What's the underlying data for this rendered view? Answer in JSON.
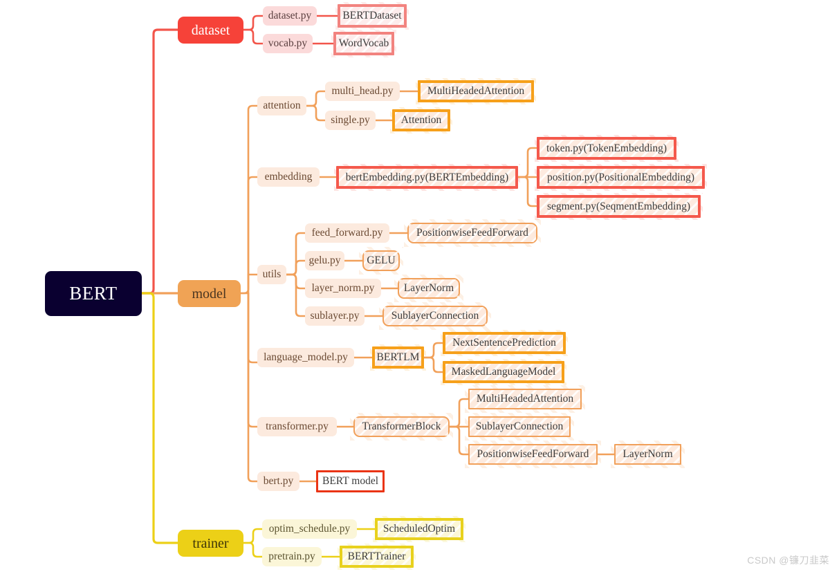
{
  "diagram": {
    "type": "mindmap",
    "title": "BERT",
    "watermark": "CSDN @镰刀韭菜"
  },
  "root": {
    "label": "BERT"
  },
  "branches": {
    "dataset": {
      "label": "dataset",
      "files": [
        {
          "label": "dataset.py",
          "leaf": "BERTDataset"
        },
        {
          "label": "vocab.py",
          "leaf": "WordVocab"
        }
      ]
    },
    "model": {
      "label": "model",
      "attention": {
        "label": "attention",
        "files": [
          {
            "label": "multi_head.py",
            "leaf": "MultiHeadedAttention"
          },
          {
            "label": "single.py",
            "leaf": "Attention"
          }
        ]
      },
      "embedding": {
        "label": "embedding",
        "file": "bertEmbedding.py(BERTEmbedding)",
        "leaves": [
          "token.py(TokenEmbedding)",
          "position.py(PositionalEmbedding)",
          "segment.py(SeqmentEmbedding)"
        ]
      },
      "utils": {
        "label": "utils",
        "files": [
          {
            "label": "feed_forward.py",
            "leaf": "PositionwiseFeedForward"
          },
          {
            "label": "gelu.py",
            "leaf": "GELU"
          },
          {
            "label": "layer_norm.py",
            "leaf": "LayerNorm"
          },
          {
            "label": "sublayer.py",
            "leaf": "SublayerConnection"
          }
        ]
      },
      "language_model": {
        "label": "language_model.py",
        "mid": "BERTLM",
        "leaves": [
          "NextSentencePrediction",
          "MaskedLanguageModel"
        ]
      },
      "transformer": {
        "label": "transformer.py",
        "mid": "TransformerBlock",
        "leaves": [
          "MultiHeadedAttention",
          "SublayerConnection",
          "PositionwiseFeedForward"
        ],
        "tail": "LayerNorm"
      },
      "bert": {
        "label": "bert.py",
        "leaf": "BERT model"
      }
    },
    "trainer": {
      "label": "trainer",
      "files": [
        {
          "label": "optim_schedule.py",
          "leaf": "ScheduledOptim"
        },
        {
          "label": "pretrain.py",
          "leaf": "BERTTrainer"
        }
      ]
    }
  },
  "colors": {
    "root_bg": "#0a0030",
    "dataset": "#f64239",
    "model": "#f0a355",
    "trainer": "#ecd017",
    "edge_red": "#f2554a",
    "edge_orange": "#f1a05a",
    "edge_yellow": "#ecd017",
    "leaf_red_border": "#f4594c",
    "leaf_orange_border": "#f6a01a",
    "leaf_yellow_border": "#e8d11d",
    "bert_model_border": "#ea3415"
  }
}
